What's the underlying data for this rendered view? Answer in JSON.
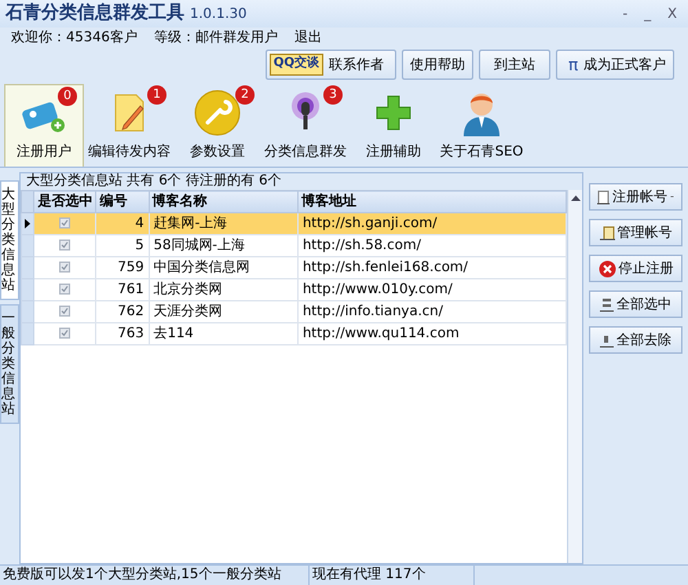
{
  "window": {
    "title": "石青分类信息群发工具",
    "version": "1.0.1.30",
    "controls": [
      "-",
      "_",
      "X"
    ]
  },
  "user_info": [
    {
      "label": "欢迎你：",
      "value": "45346客户"
    },
    {
      "label": "等级：",
      "value": "邮件群发用户"
    }
  ],
  "logout": "退出",
  "top_buttons": [
    {
      "kind": "qq",
      "badge": "QQ交谈",
      "label": "联系作者"
    },
    {
      "kind": "plain",
      "label": "使用帮助"
    },
    {
      "kind": "plain",
      "label": "到主站"
    },
    {
      "kind": "pi",
      "icon_text": "π",
      "label": "成为正式客户"
    }
  ],
  "toolbar": [
    {
      "label": "注册用户",
      "badge": "0",
      "kind": "tag",
      "selected": true
    },
    {
      "label": "编辑待发内容",
      "badge": "1",
      "kind": "note",
      "selected": false
    },
    {
      "label": "参数设置",
      "badge": "2",
      "kind": "wrench",
      "selected": false
    },
    {
      "label": "分类信息群发",
      "badge": "3",
      "kind": "mic",
      "selected": false
    },
    {
      "label": "注册辅助",
      "kind": "plus",
      "selected": false
    },
    {
      "label": "关于石青SEO",
      "kind": "person",
      "selected": false
    }
  ],
  "side_tabs": [
    {
      "label": "大型分类信息站",
      "selected": true
    },
    {
      "label": "一般分类信息站",
      "selected": false
    }
  ],
  "grid": {
    "caption": "大型分类信息站 共有 6个 待注册的有 6个",
    "columns": [
      "是否选中",
      "编号",
      "博客名称",
      "博客地址"
    ],
    "rows": [
      {
        "checked": true,
        "selected": true,
        "id": "4",
        "name": "赶集网-上海",
        "url": "http://sh.ganji.com/"
      },
      {
        "checked": true,
        "selected": false,
        "id": "5",
        "name": "58同城网-上海",
        "url": "http://sh.58.com/"
      },
      {
        "checked": true,
        "selected": false,
        "id": "759",
        "name": "中国分类信息网",
        "url": "http://sh.fenlei168.com/"
      },
      {
        "checked": true,
        "selected": false,
        "id": "761",
        "name": "北京分类网",
        "url": "http://www.010y.com/"
      },
      {
        "checked": true,
        "selected": false,
        "id": "762",
        "name": "天涯分类网",
        "url": "http://info.tianya.cn/"
      },
      {
        "checked": true,
        "selected": false,
        "id": "763",
        "name": "去114",
        "url": "http://www.qu114.com"
      }
    ]
  },
  "side_buttons": [
    {
      "kind": "dropdown",
      "label": "注册帐号",
      "caret": "-"
    },
    {
      "kind": "manage",
      "label": "管理帐号"
    },
    {
      "kind": "stop",
      "label": "停止注册"
    },
    {
      "kind": "all",
      "label": "全部选中"
    },
    {
      "kind": "none",
      "label": "全部去除"
    }
  ],
  "status_bar": [
    "免费版可以发1个大型分类站,15个一般分类站",
    "现在有代理 117个"
  ]
}
